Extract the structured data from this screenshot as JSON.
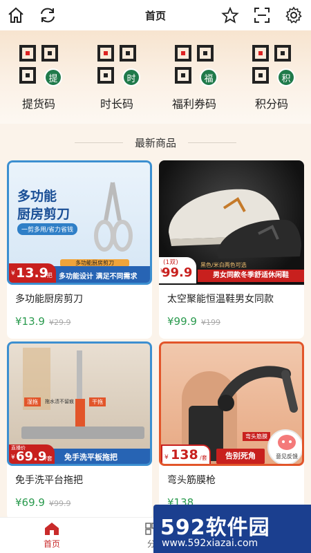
{
  "header": {
    "title": "首页",
    "icons": [
      "home-icon",
      "refresh-icon",
      "star-icon",
      "scan-icon",
      "settings-icon"
    ]
  },
  "codes": [
    {
      "label": "提货码",
      "badge": "提"
    },
    {
      "label": "时长码",
      "badge": "时"
    },
    {
      "label": "福利券码",
      "badge": "福"
    },
    {
      "label": "积分码",
      "badge": "积"
    }
  ],
  "section": {
    "title": "最新商品"
  },
  "products": [
    {
      "name": "多功能厨房剪刀",
      "price": "¥13.9",
      "old_price": "¥29.9",
      "img": {
        "headline1": "多功能",
        "headline2": "厨房剪刀",
        "tagline": "一剪多用/省力省钱",
        "ribbon": "多功能厨房剪刀",
        "price_tag": "13.9",
        "price_prefix": "¥",
        "price_unit": "/把",
        "slogan": "多功能设计 满足不同需求"
      }
    },
    {
      "name": "太空聚能恒温鞋男女同款",
      "price": "¥99.9",
      "old_price": "¥199",
      "img": {
        "qty": "(1双)",
        "price_tag": "99.9",
        "price_prefix": "¥",
        "colors": "黑色/米白两色可选",
        "slogan": "男女同款冬季舒适休闲鞋"
      }
    },
    {
      "name": "免手洗平台拖把",
      "price": "¥69.9",
      "old_price": "¥99.9",
      "img": {
        "tag1": "湿拖",
        "tag1_desc": "拖水渍不留痕",
        "tag2": "干拖",
        "tag2_desc": "",
        "price_label": "直播价",
        "price_tag": "69.9",
        "price_prefix": "¥",
        "price_unit": "/套",
        "slogan": "免手洗平板拖把"
      }
    },
    {
      "name": "弯头筋膜枪",
      "price": "¥138",
      "old_price": "",
      "img": {
        "price_tag": "138",
        "price_prefix": "¥",
        "price_unit": "/套",
        "ribbon": "弯头筋膜",
        "slogan": "告别死角",
        "feedback": "意见反馈"
      }
    }
  ],
  "bottom_nav": [
    {
      "label": "首页",
      "active": true
    },
    {
      "label": "分",
      "active": false
    }
  ],
  "watermark": {
    "brand": "592软件园",
    "url": "www.592xiazai.com"
  },
  "colors": {
    "accent_green": "#2a9a4e",
    "badge_green": "#1f7a4a",
    "nav_active": "#c92a2a",
    "price_red": "#c8201e"
  }
}
